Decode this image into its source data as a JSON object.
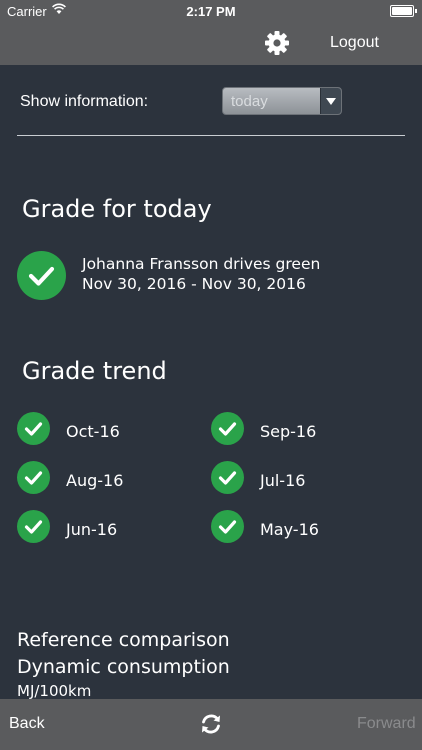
{
  "status_bar": {
    "carrier": "Carrier",
    "time": "2:17 PM"
  },
  "nav": {
    "settings_icon": "gear-icon",
    "logout_label": "Logout"
  },
  "filter": {
    "label": "Show information:",
    "selected": "today"
  },
  "grade_today": {
    "title": "Grade for today",
    "driver_text": "Johanna Fransson drives green",
    "date_range": "Nov 30, 2016 - Nov 30, 2016"
  },
  "grade_trend": {
    "title": "Grade trend",
    "items": [
      {
        "label": "Oct-16"
      },
      {
        "label": "Sep-16"
      },
      {
        "label": "Aug-16"
      },
      {
        "label": "Jul-16"
      },
      {
        "label": "Jun-16"
      },
      {
        "label": "May-16"
      }
    ]
  },
  "reference": {
    "line1": "Reference comparison",
    "line2": "Dynamic consumption",
    "unit": "MJ/100km"
  },
  "toolbar": {
    "back_label": "Back",
    "refresh_icon": "refresh-icon",
    "forward_label": "Forward"
  },
  "colors": {
    "background": "#2c333d",
    "bar": "#5a5b5d",
    "check_green": "#2aa34a"
  }
}
